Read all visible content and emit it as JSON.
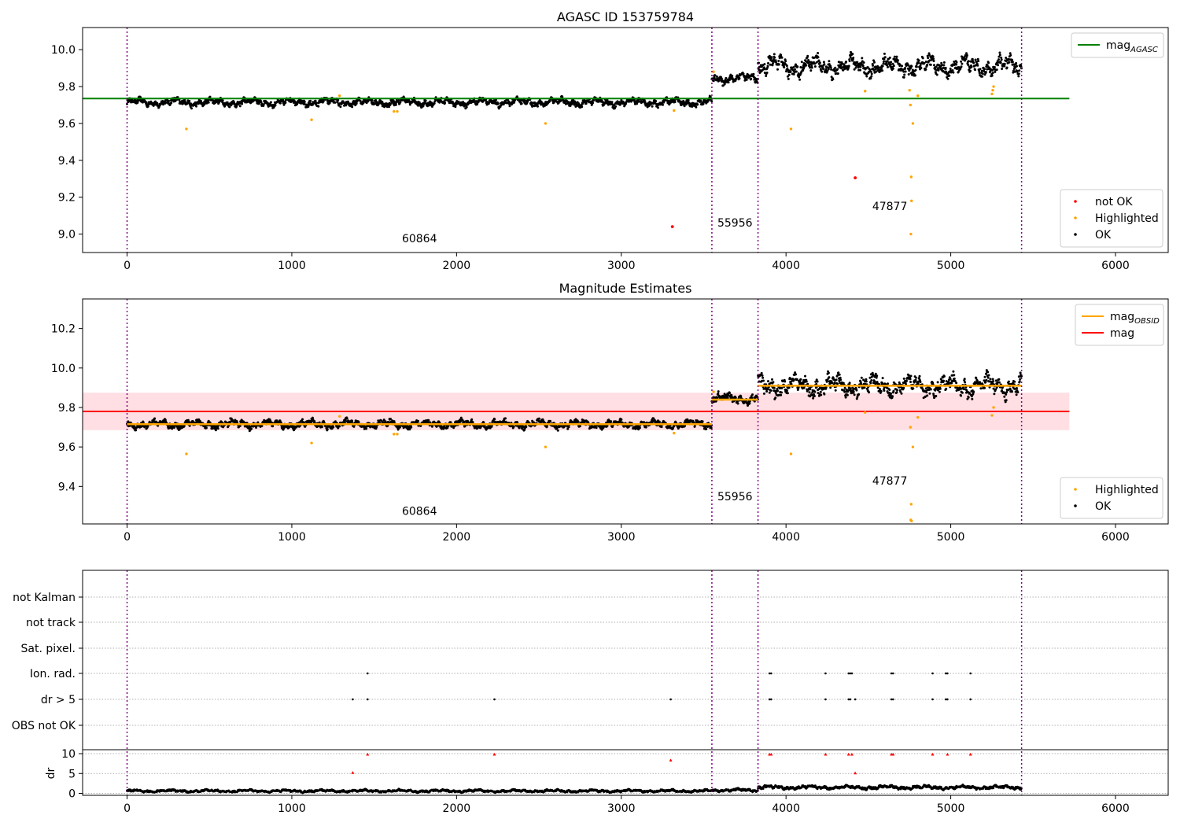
{
  "figure": {
    "panels": [
      {
        "id": "p1",
        "title": "AGASC ID 153759784"
      },
      {
        "id": "p2",
        "title": "Magnitude Estimates"
      },
      {
        "id": "p3",
        "title": ""
      }
    ]
  },
  "chart_data": [
    {
      "type": "scatter",
      "title": "AGASC ID 153759784",
      "xlim": [
        -270,
        6320
      ],
      "ylim": [
        8.9,
        10.12
      ],
      "xticks": [
        0,
        1000,
        2000,
        3000,
        4000,
        5000,
        6000
      ],
      "yticks": [
        9.0,
        9.2,
        9.4,
        9.6,
        9.8,
        10.0
      ],
      "ytick_labels": [
        "9.0",
        "9.2",
        "9.4",
        "9.6",
        "9.8",
        "10.0"
      ],
      "legend_position": "upper-right and lower-right",
      "legend_top": [
        {
          "label": "mag",
          "sub": "AGASC",
          "color": "#008000",
          "kind": "line"
        }
      ],
      "legend_bottom": [
        {
          "label": "not OK",
          "color": "#ff0000",
          "kind": "dot"
        },
        {
          "label": "Highlighted",
          "color": "#ffa500",
          "kind": "dot"
        },
        {
          "label": "OK",
          "color": "#000000",
          "kind": "dot"
        }
      ],
      "hlines": [
        {
          "y": 9.735,
          "x": [
            -270,
            5720
          ],
          "color": "#008000"
        }
      ],
      "vlines": [
        0,
        3550,
        3830,
        5430
      ],
      "segments": [
        {
          "x": [
            0,
            3550
          ],
          "base": 9.715,
          "amp": 0.025
        },
        {
          "x": [
            3550,
            3830
          ],
          "base": 9.845,
          "amp": 0.03
        },
        {
          "x": [
            3830,
            5430
          ],
          "base": 9.91,
          "amp": 0.06
        }
      ],
      "highlighted": [
        [
          360,
          9.57
        ],
        [
          1120,
          9.62
        ],
        [
          1290,
          9.75
        ],
        [
          1620,
          9.665
        ],
        [
          1640,
          9.665
        ],
        [
          2540,
          9.6
        ],
        [
          3320,
          9.67
        ],
        [
          3560,
          9.88
        ],
        [
          4030,
          9.57
        ],
        [
          4480,
          9.775
        ],
        [
          4750,
          9.78
        ],
        [
          4755,
          9.7
        ],
        [
          4760,
          9.31
        ],
        [
          4762,
          9.18
        ],
        [
          4758,
          9.0
        ],
        [
          4770,
          9.6
        ],
        [
          4800,
          9.75
        ],
        [
          5250,
          9.76
        ],
        [
          5255,
          9.78
        ],
        [
          5260,
          9.8
        ]
      ],
      "not_ok": [
        [
          3310,
          9.04
        ],
        [
          4420,
          9.305
        ]
      ],
      "annotations": [
        {
          "text": "60864",
          "x": 1775,
          "y": 8.955
        },
        {
          "text": "55956",
          "x": 3690,
          "y": 9.04
        },
        {
          "text": "47877",
          "x": 4630,
          "y": 9.13
        }
      ]
    },
    {
      "type": "scatter",
      "title": "Magnitude Estimates",
      "xlim": [
        -270,
        6320
      ],
      "ylim": [
        9.21,
        10.35
      ],
      "xticks": [
        0,
        1000,
        2000,
        3000,
        4000,
        5000,
        6000
      ],
      "yticks": [
        9.4,
        9.6,
        9.8,
        10.0,
        10.2
      ],
      "ytick_labels": [
        "9.4",
        "9.6",
        "9.8",
        "10.0",
        "10.2"
      ],
      "legend_position": "upper-right and lower-right",
      "legend_top": [
        {
          "label": "mag",
          "sub": "OBSID",
          "color": "#ffa500",
          "kind": "line"
        },
        {
          "label": "mag",
          "sub": "",
          "color": "#ff0000",
          "kind": "line"
        }
      ],
      "legend_bottom": [
        {
          "label": "Highlighted",
          "color": "#ffa500",
          "kind": "dot"
        },
        {
          "label": "OK",
          "color": "#000000",
          "kind": "dot"
        }
      ],
      "band": {
        "y": [
          9.685,
          9.875
        ],
        "x": [
          -270,
          5720
        ],
        "color": "#ffdfe3"
      },
      "hlines": [
        {
          "y": 9.78,
          "x": [
            -270,
            5720
          ],
          "color": "#ff0000"
        }
      ],
      "obsid_lines": [
        {
          "x": [
            0,
            3550
          ],
          "y": 9.715
        },
        {
          "x": [
            3550,
            3830
          ],
          "y": 9.84
        },
        {
          "x": [
            3830,
            5430
          ],
          "y": 9.91
        }
      ],
      "vlines": [
        0,
        3550,
        3830,
        5430
      ],
      "segments": [
        {
          "x": [
            0,
            3550
          ],
          "base": 9.715,
          "amp": 0.025
        },
        {
          "x": [
            3550,
            3830
          ],
          "base": 9.845,
          "amp": 0.03
        },
        {
          "x": [
            3830,
            5430
          ],
          "base": 9.91,
          "amp": 0.06
        }
      ],
      "highlighted": [
        [
          360,
          9.565
        ],
        [
          1120,
          9.62
        ],
        [
          1290,
          9.755
        ],
        [
          1620,
          9.665
        ],
        [
          1640,
          9.665
        ],
        [
          2540,
          9.6
        ],
        [
          3320,
          9.67
        ],
        [
          3560,
          9.88
        ],
        [
          4030,
          9.565
        ],
        [
          4480,
          9.775
        ],
        [
          4755,
          9.7
        ],
        [
          4760,
          9.31
        ],
        [
          4757,
          9.23
        ],
        [
          4762,
          9.225
        ],
        [
          4770,
          9.6
        ],
        [
          4800,
          9.75
        ],
        [
          5250,
          9.76
        ],
        [
          5260,
          9.8
        ]
      ],
      "annotations": [
        {
          "text": "60864",
          "x": 1775,
          "y": 9.255
        },
        {
          "text": "55956",
          "x": 3690,
          "y": 9.33
        },
        {
          "text": "47877",
          "x": 4630,
          "y": 9.41
        }
      ]
    },
    {
      "type": "scatter",
      "title": "",
      "xlim": [
        -270,
        6320
      ],
      "ytick_labels": [
        "not Kalman",
        "not track",
        "Sat. pixel.",
        "Ion. rad.",
        "dr > 5",
        "OBS not OK"
      ],
      "xticks": [
        0,
        1000,
        2000,
        3000,
        4000,
        5000,
        6000
      ],
      "vlines": [
        0,
        3550,
        3830,
        5430
      ],
      "flags": {
        "Ion. rad.": [
          1460,
          3900,
          3910,
          4240,
          4380,
          4390,
          4400,
          4640,
          4650,
          4890,
          4970,
          4980,
          5120
        ],
        "dr > 5": [
          1370,
          1460,
          2230,
          3300,
          3900,
          3910,
          4240,
          4380,
          4390,
          4420,
          4640,
          4650,
          4890,
          4970,
          4980,
          5120
        ]
      },
      "dr_ylabel": "dr",
      "dr_ylim": [
        -0.5,
        11
      ],
      "dr_yticks": [
        0,
        5,
        10
      ],
      "dr_ytick_labels": [
        "0",
        "5",
        "10"
      ],
      "dr_segments": [
        {
          "x": [
            0,
            3550
          ],
          "base": 0.6,
          "amp": 0.35
        },
        {
          "x": [
            3550,
            3830
          ],
          "base": 0.8,
          "amp": 0.4
        },
        {
          "x": [
            3830,
            5430
          ],
          "base": 1.5,
          "amp": 0.5
        }
      ],
      "dr_red": [
        [
          1370,
          5.2
        ],
        [
          1460,
          9.8
        ],
        [
          2230,
          9.8
        ],
        [
          3300,
          8.3
        ],
        [
          3900,
          9.8
        ],
        [
          3910,
          9.8
        ],
        [
          4240,
          9.8
        ],
        [
          4380,
          9.8
        ],
        [
          4400,
          9.8
        ],
        [
          4420,
          5.1
        ],
        [
          4640,
          9.8
        ],
        [
          4650,
          9.8
        ],
        [
          4890,
          9.8
        ],
        [
          4980,
          9.8
        ],
        [
          5120,
          9.8
        ]
      ]
    }
  ]
}
